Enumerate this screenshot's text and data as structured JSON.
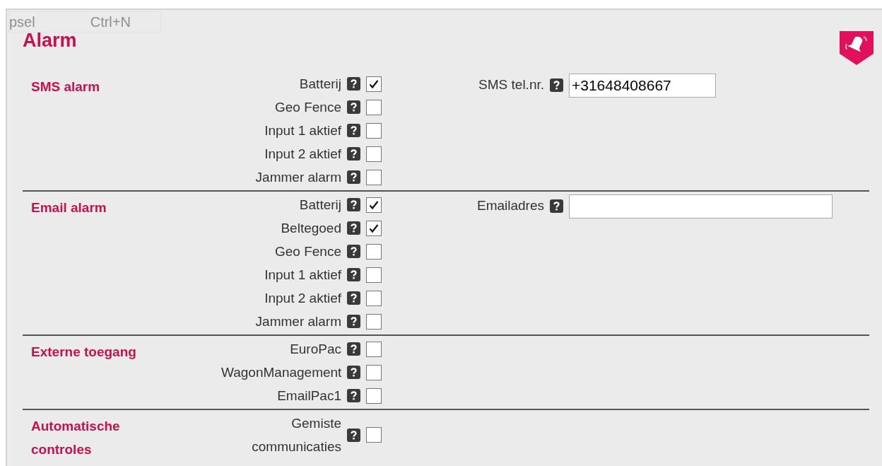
{
  "ghost_menu_item": {
    "label": "psel",
    "shortcut": "Ctrl+N"
  },
  "title": "Alarm",
  "sections": [
    {
      "title": "SMS alarm",
      "options": [
        {
          "label": "Batterij",
          "checked": true
        },
        {
          "label": "Geo Fence",
          "checked": false
        },
        {
          "label": "Input 1 aktief",
          "checked": false
        },
        {
          "label": "Input 2 aktief",
          "checked": false
        },
        {
          "label": "Jammer alarm",
          "checked": false
        }
      ],
      "field": {
        "label": "SMS tel.nr.",
        "value": "+31648408667",
        "wide": false
      }
    },
    {
      "title": "Email alarm",
      "options": [
        {
          "label": "Batterij",
          "checked": true
        },
        {
          "label": "Beltegoed",
          "checked": true
        },
        {
          "label": "Geo Fence",
          "checked": false
        },
        {
          "label": "Input 1 aktief",
          "checked": false
        },
        {
          "label": "Input 2 aktief",
          "checked": false
        },
        {
          "label": "Jammer alarm",
          "checked": false
        }
      ],
      "field": {
        "label": "Emailadres",
        "wide": true
      }
    },
    {
      "title": "Externe toegang",
      "options": [
        {
          "label": "EuroPac",
          "checked": false
        },
        {
          "label": "WagonManagement",
          "checked": false
        },
        {
          "label": "EmailPac1",
          "checked": false
        }
      ]
    },
    {
      "title": "Automatische controles",
      "options": [
        {
          "label": "Gemiste communicaties",
          "checked": false
        }
      ]
    }
  ]
}
